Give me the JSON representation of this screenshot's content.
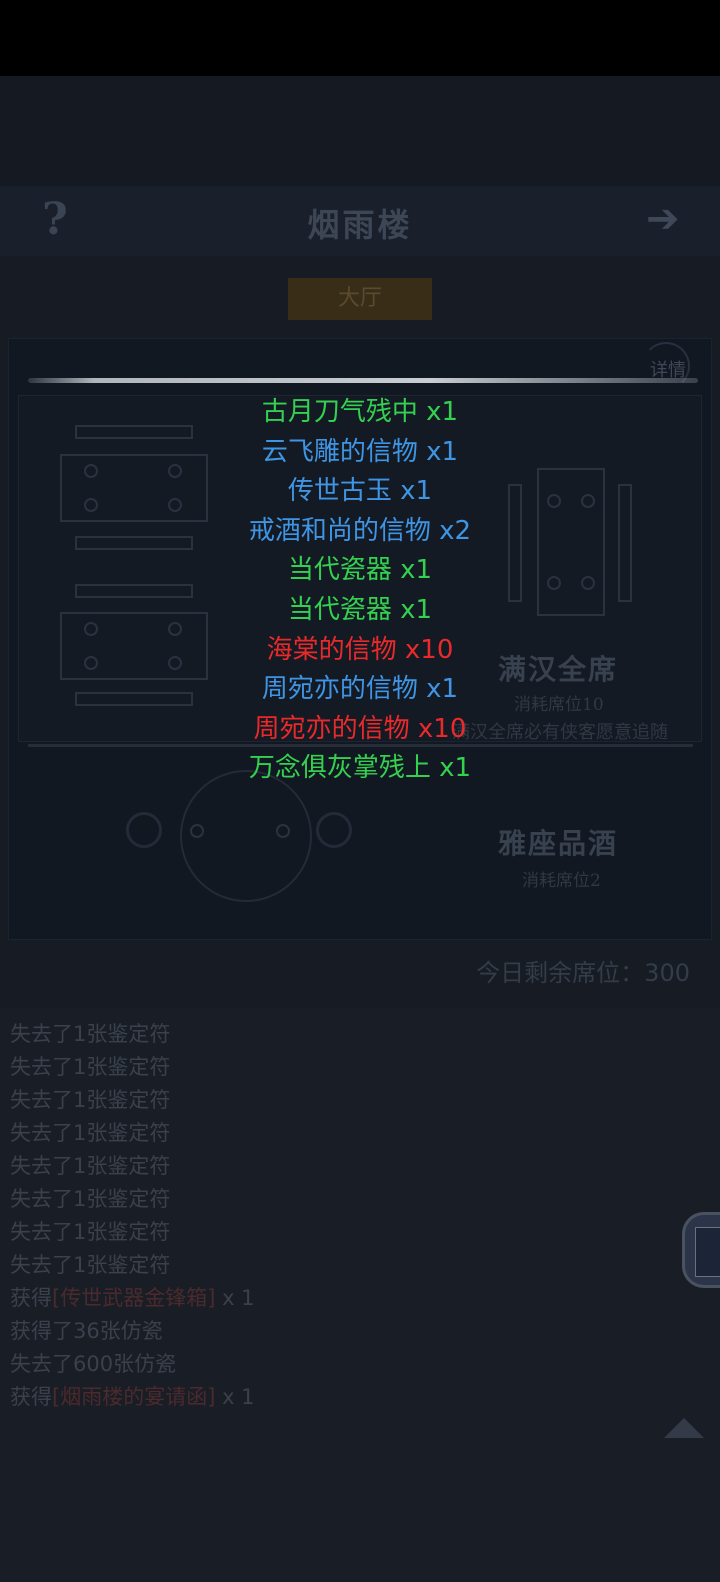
{
  "header": {
    "help": "?",
    "title": "烟雨楼",
    "next": "➔"
  },
  "tab": {
    "label": "大厅"
  },
  "details_label": "详情",
  "tables": {
    "full_feast": {
      "name": "满汉全席",
      "cost": "消耗席位10",
      "desc": "满汉全席必有侠客愿意追随"
    },
    "fine_wine": {
      "name": "雅座品酒",
      "cost": "消耗席位2"
    }
  },
  "seats_remaining": {
    "text": "今日剩余席位：300"
  },
  "rewards": [
    {
      "text": "古月刀气残中 x1",
      "color": "#34d04f"
    },
    {
      "text": "云飞雕的信物 x1",
      "color": "#3f95e3"
    },
    {
      "text": "传世古玉 x1",
      "color": "#3f95e3"
    },
    {
      "text": "戒酒和尚的信物 x2",
      "color": "#3f95e3"
    },
    {
      "text": "当代瓷器 x1",
      "color": "#34d04f"
    },
    {
      "text": "当代瓷器 x1",
      "color": "#34d04f"
    },
    {
      "text": "海棠的信物 x10",
      "color": "#ea2a2a"
    },
    {
      "text": "周宛亦的信物 x1",
      "color": "#3f95e3"
    },
    {
      "text": "周宛亦的信物 x10",
      "color": "#ea2a2a"
    },
    {
      "text": "万念俱灰掌残上 x1",
      "color": "#34d04f"
    }
  ],
  "log": [
    {
      "text": "失去了1张鉴定符"
    },
    {
      "text": "失去了1张鉴定符"
    },
    {
      "text": "失去了1张鉴定符"
    },
    {
      "text": "失去了1张鉴定符"
    },
    {
      "text": "失去了1张鉴定符"
    },
    {
      "text": "失去了1张鉴定符"
    },
    {
      "text": "失去了1张鉴定符"
    },
    {
      "text": "失去了1张鉴定符"
    },
    {
      "prefix": "获得",
      "item": "[传世武器金锋箱]",
      "suffix": " x 1"
    },
    {
      "text": "获得了36张仿瓷"
    },
    {
      "text": "失去了600张仿瓷"
    },
    {
      "prefix": "获得",
      "item": "[烟雨楼的宴请函]",
      "suffix": " x 1"
    }
  ],
  "colors": {
    "reward_green": "#34d04f",
    "reward_blue": "#3f95e3",
    "reward_red": "#ea2a2a"
  }
}
